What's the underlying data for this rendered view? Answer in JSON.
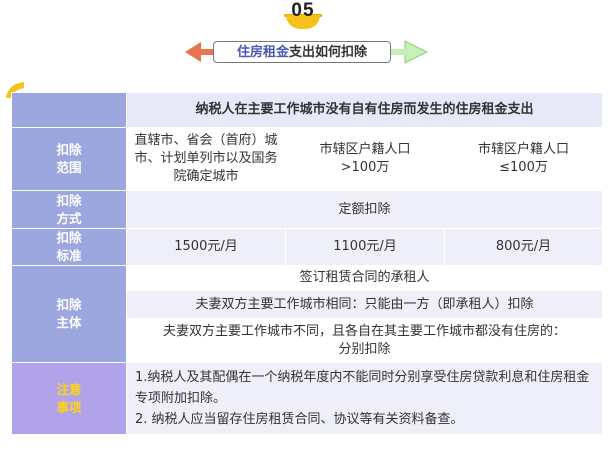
{
  "header": {
    "number": "05",
    "title_highlight": "住房租金",
    "title_rest": "支出如何扣除"
  },
  "table": {
    "title": "纳税人在主要工作城市没有自有住房而发生的住房租金支出",
    "rows": {
      "scope": {
        "label": "扣除\n范围",
        "cells": [
          "直辖市、省会（首府）城市、计划单列市以及国务院确定城市",
          "市辖区户籍人口\n>100万",
          "市辖区户籍人口\n≤100万"
        ]
      },
      "method": {
        "label": "扣除\n方式",
        "value": "定额扣除"
      },
      "standard": {
        "label": "扣除\n标准",
        "cells": [
          "1500元/月",
          "1100元/月",
          "800元/月"
        ]
      },
      "subject": {
        "label": "扣除\n主体",
        "lines": [
          "签订租赁合同的承租人",
          "夫妻双方主要工作城市相同：只能由一方（即承租人）扣除",
          "夫妻双方主要工作城市不同，且各自在其主要工作城市都没有住房的：分别扣除"
        ]
      },
      "notes": {
        "label": "注意\n事项",
        "lines": [
          "1.纳税人及其配偶在一个纳税年度内不能同时分别享受住房贷款利息和住房租金专项附加扣除。",
          "2. 纳税人应当留存住房租赁合同、协议等有关资料备查。"
        ]
      }
    }
  },
  "colors": {
    "header_cell": "#9da7df",
    "notes_header_cell": "#b1a3e9",
    "notes_label": "#ffd21a",
    "title_row": "#e7e9f8",
    "shaded_cell": "#eeeff8",
    "badge": "#f4c21b",
    "banner_accent": "#4a59b8"
  }
}
